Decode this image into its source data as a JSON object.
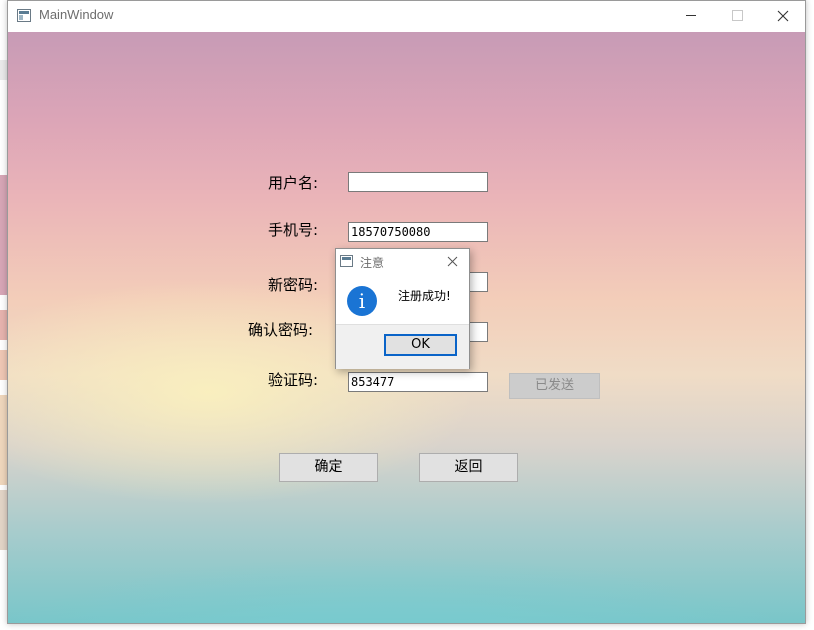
{
  "window": {
    "title": "MainWindow"
  },
  "form": {
    "username": {
      "label": "用户名:",
      "value": ""
    },
    "phone": {
      "label": "手机号:",
      "value": "18570750080"
    },
    "new_password": {
      "label": "新密码:",
      "value": ""
    },
    "confirm_password": {
      "label": "确认密码:",
      "value": ""
    },
    "code": {
      "label": "验证码:",
      "value": "853477"
    },
    "sent_button_label": "已发送",
    "confirm_button_label": "确定",
    "back_button_label": "返回"
  },
  "dialog": {
    "title": "注意",
    "message": "注册成功!",
    "ok_label": "OK",
    "icon": "info-icon"
  },
  "colors": {
    "dialog_accent": "#0a64c8",
    "info_icon": "#1a74d4"
  }
}
